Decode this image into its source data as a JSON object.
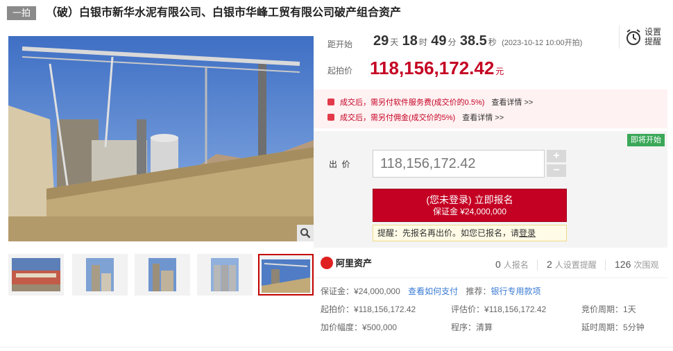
{
  "header": {
    "round_tag": "一拍",
    "title": "（破）白银市新华水泥有限公司、白银市华峰工贸有限公司破产组合资产"
  },
  "countdown": {
    "label": "距开始",
    "days": "29",
    "days_unit": "天",
    "hours": "18",
    "hours_unit": "时",
    "minutes": "49",
    "minutes_unit": "分",
    "seconds": "38.5",
    "seconds_unit": "秒",
    "start_note": "(2023-10-12 10:00开拍)"
  },
  "reminder": {
    "line1": "设置",
    "line2": "提醒"
  },
  "starting_price": {
    "label": "起拍价",
    "value": "118,156,172.42",
    "unit": "元"
  },
  "fees": [
    {
      "text": "成交后，需另付软件服务费(成交价的0.5%)",
      "link": "查看详情 >>"
    },
    {
      "text": "成交后，需另付佣金(成交价的5%)",
      "link": "查看详情 >>"
    }
  ],
  "bid": {
    "status_badge": "即将开始",
    "label": "出  价",
    "input_value": "118,156,172.42",
    "plus": "+",
    "minus": "−",
    "signup_line1": "(您未登录) 立即报名",
    "signup_line2": "保证金 ¥24,000,000",
    "hint_text": "提醒：先报名再出价。如您已报名，请",
    "hint_link": "登录"
  },
  "platform": {
    "name": "阿里资产",
    "signups_count": "0",
    "signups_label": "人报名",
    "reminders_count": "2",
    "reminders_label": "人设置提醒",
    "views_count": "126",
    "views_label": "次围观"
  },
  "details": {
    "deposit_label": "保证金：",
    "deposit_value": "¥24,000,000",
    "pay_link": "查看如何支付",
    "recommend_label": "推荐：",
    "recommend_link": "银行专用款项",
    "start_label": "起拍价：",
    "start_value": "¥118,156,172.42",
    "appraisal_label": "评估价：",
    "appraisal_value": "¥118,156,172.42",
    "cycle_label": "竞价周期：",
    "cycle_value": "1天",
    "increment_label": "加价幅度：",
    "increment_value": "¥500,000",
    "procedure_label": "程序：",
    "procedure_value": "清算",
    "delay_label": "延时周期：",
    "delay_value": "5分钟"
  },
  "colors": {
    "accent": "#c40023",
    "badge": "#3aa858",
    "link": "#3a7bd5",
    "fee_bg": "#fff2f2",
    "bid_bg": "#f4f4f4"
  },
  "icons": [
    "zoom-icon",
    "alarm-clock-icon",
    "fee-icon",
    "alibaba-logo-icon"
  ]
}
